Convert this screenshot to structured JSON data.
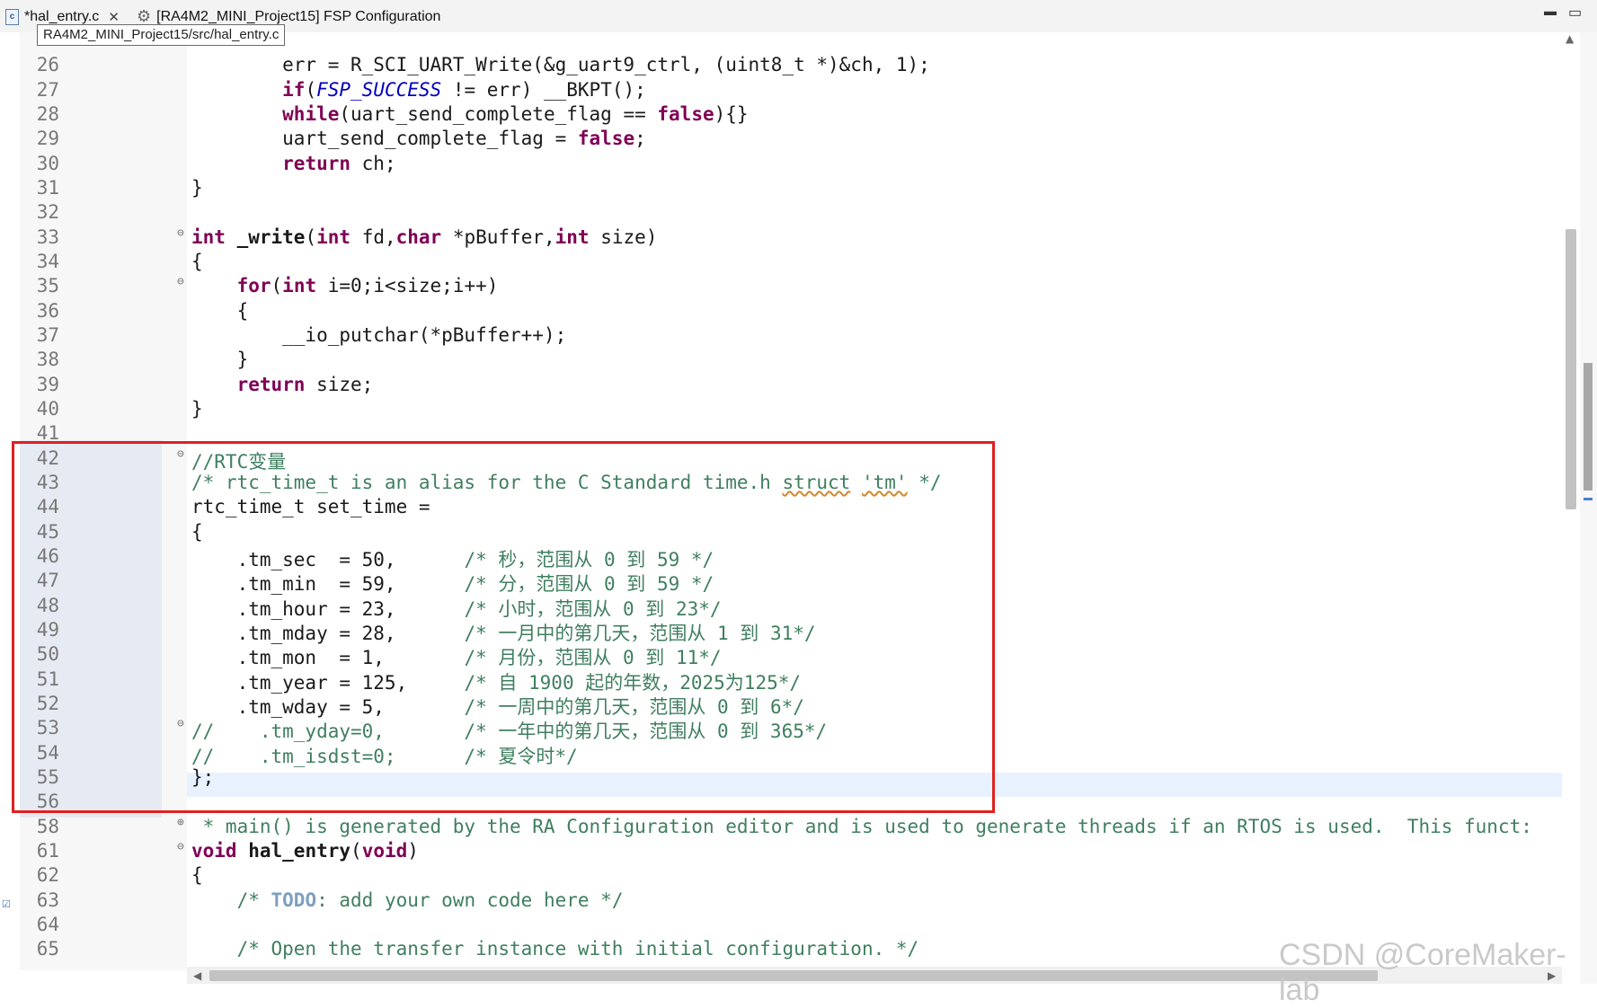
{
  "tabs": {
    "active": {
      "label": "*hal_entry.c",
      "icon": "c-file-icon"
    },
    "second": {
      "label": "[RA4M2_MINI_Project15] FSP Configuration",
      "icon": "gear-icon"
    }
  },
  "window_controls": {
    "minimize": "▭",
    "maximize": "▭"
  },
  "tooltip": "RA4M2_MINI_Project15/src/hal_entry.c",
  "watermark": "CSDN @CoreMaker-lab",
  "colors": {
    "keyword": "#7f0055",
    "comment": "#3f7f5f",
    "macro": "#0000c0",
    "highlight_box": "#e02020"
  },
  "lines": [
    {
      "n": "26",
      "code": "        err = R_SCI_UART_Write(&g_uart9_ctrl, (uint8_t *)&ch, 1);"
    },
    {
      "n": "27",
      "code": "        if(FSP_SUCCESS != err) __BKPT();"
    },
    {
      "n": "28",
      "code": "        while(uart_send_complete_flag == false){}"
    },
    {
      "n": "29",
      "code": "        uart_send_complete_flag = false;"
    },
    {
      "n": "30",
      "code": "        return ch;"
    },
    {
      "n": "31",
      "code": "}"
    },
    {
      "n": "32",
      "code": ""
    },
    {
      "n": "33",
      "code": "int _write(int fd,char *pBuffer,int size)"
    },
    {
      "n": "34",
      "code": "{"
    },
    {
      "n": "35",
      "code": "    for(int i=0;i<size;i++)"
    },
    {
      "n": "36",
      "code": "    {"
    },
    {
      "n": "37",
      "code": "        __io_putchar(*pBuffer++);"
    },
    {
      "n": "38",
      "code": "    }"
    },
    {
      "n": "39",
      "code": "    return size;"
    },
    {
      "n": "40",
      "code": "}"
    },
    {
      "n": "41",
      "code": ""
    },
    {
      "n": "42",
      "code": "//RTC变量"
    },
    {
      "n": "43",
      "code": "/* rtc_time_t is an alias for the C Standard time.h struct 'tm' */"
    },
    {
      "n": "44",
      "code": "rtc_time_t set_time ="
    },
    {
      "n": "45",
      "code": "{"
    },
    {
      "n": "46",
      "code": "    .tm_sec  = 50,      /* 秒，范围从 0 到 59 */"
    },
    {
      "n": "47",
      "code": "    .tm_min  = 59,      /* 分，范围从 0 到 59 */"
    },
    {
      "n": "48",
      "code": "    .tm_hour = 23,      /* 小时，范围从 0 到 23*/"
    },
    {
      "n": "49",
      "code": "    .tm_mday = 28,      /* 一月中的第几天，范围从 1 到 31*/"
    },
    {
      "n": "50",
      "code": "    .tm_mon  = 1,       /* 月份，范围从 0 到 11*/"
    },
    {
      "n": "51",
      "code": "    .tm_year = 125,     /* 自 1900 起的年数，2025为125*/"
    },
    {
      "n": "52",
      "code": "    .tm_wday = 5,       /* 一周中的第几天，范围从 0 到 6*/"
    },
    {
      "n": "53",
      "code": "//    .tm_yday=0,       /* 一年中的第几天，范围从 0 到 365*/"
    },
    {
      "n": "54",
      "code": "//    .tm_isdst=0;      /* 夏令时*/"
    },
    {
      "n": "55",
      "code": "};"
    },
    {
      "n": "56",
      "code": ""
    },
    {
      "n": "58",
      "code": " * main() is generated by the RA Configuration editor and is used to generate threads if an RTOS is used.  This funct:"
    },
    {
      "n": "61",
      "code": "void hal_entry(void)"
    },
    {
      "n": "62",
      "code": "{"
    },
    {
      "n": "63",
      "code": "    /* TODO: add your own code here */"
    },
    {
      "n": "64",
      "code": ""
    },
    {
      "n": "65",
      "code": "    /* Open the transfer instance with initial configuration. */"
    }
  ]
}
